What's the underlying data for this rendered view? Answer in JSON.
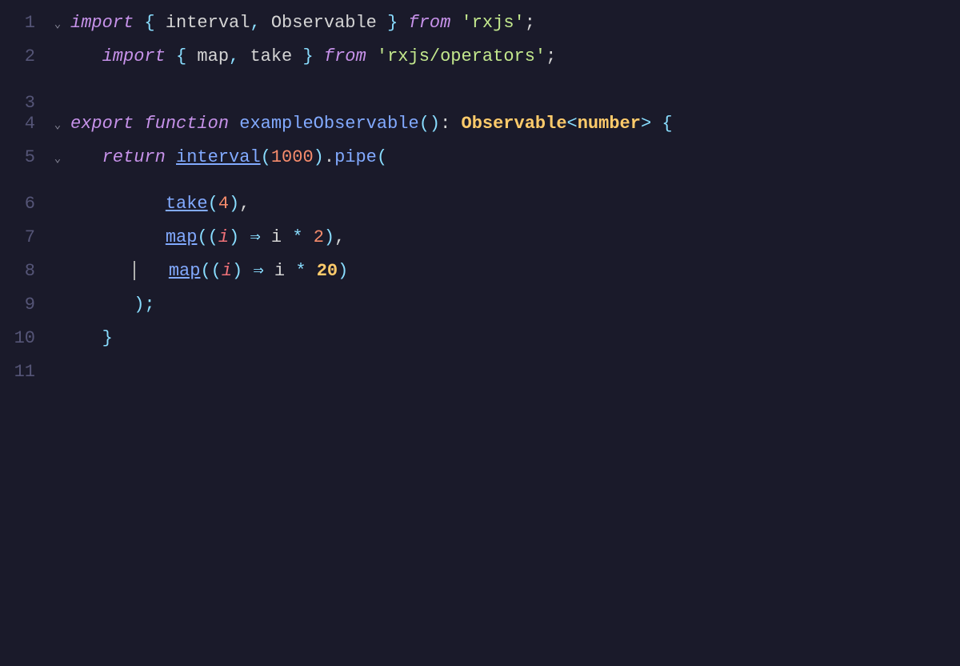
{
  "editor": {
    "background": "#1a1a2a",
    "lines": [
      {
        "number": "1",
        "hasFold": true,
        "foldOpen": true
      },
      {
        "number": "2",
        "hasFold": false
      },
      {
        "number": "3",
        "hasFold": false
      },
      {
        "number": "4",
        "hasFold": true,
        "foldOpen": true
      },
      {
        "number": "5",
        "hasFold": true,
        "foldOpen": true
      },
      {
        "number": "6",
        "hasFold": false
      },
      {
        "number": "7",
        "hasFold": false
      },
      {
        "number": "8",
        "hasFold": false,
        "hasCursor": true
      },
      {
        "number": "9",
        "hasFold": false
      },
      {
        "number": "10",
        "hasFold": false
      },
      {
        "number": "11",
        "hasFold": false
      }
    ]
  }
}
